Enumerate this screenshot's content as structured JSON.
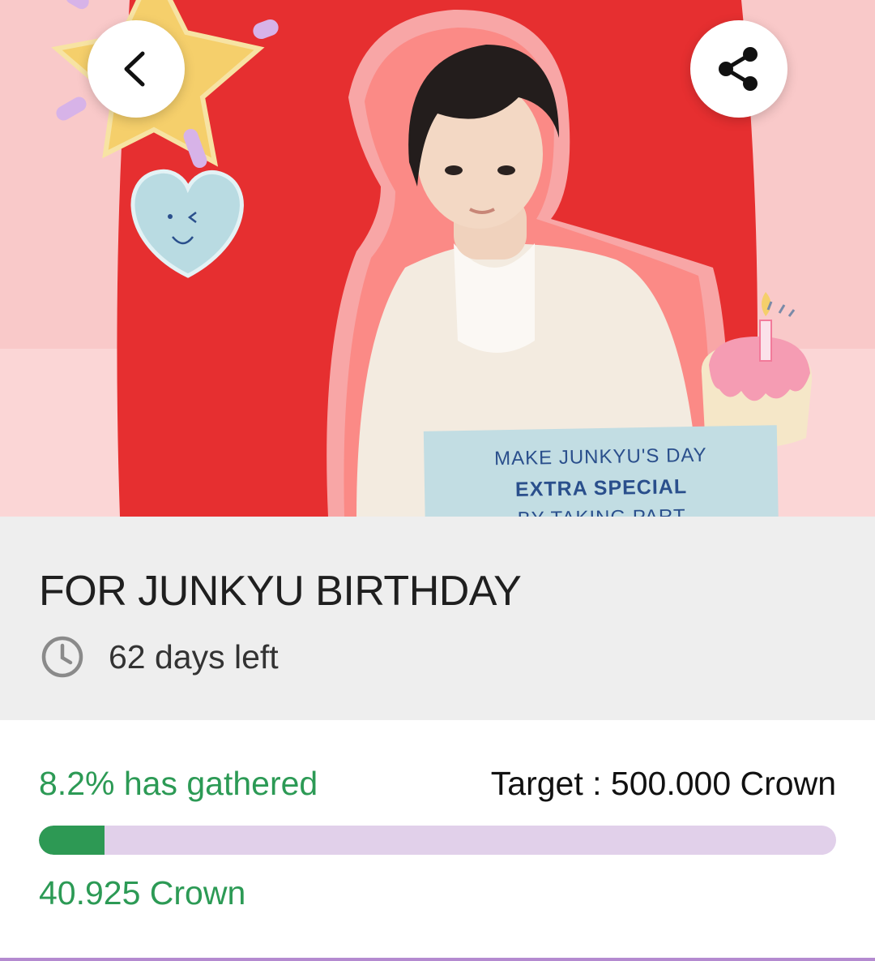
{
  "banner": {
    "caption_line1": "MAKE JUNKYU'S DAY",
    "caption_line2": "EXTRA SPECIAL",
    "caption_line3": "BY TAKING PART"
  },
  "nav": {
    "back_icon": "chevron-left-icon",
    "share_icon": "share-icon"
  },
  "campaign": {
    "title": "FOR JUNKYU BIRTHDAY",
    "clock_icon": "clock-icon",
    "days_left": "62 days left"
  },
  "progress": {
    "gathered_label": "8.2% has gathered",
    "target_label": "Target : 500.000 Crown",
    "collected_label": "40.925 Crown",
    "fraction": 0.082
  },
  "colors": {
    "accent_green": "#2c9a55",
    "track_lavender": "#e1d0ea",
    "banner_red": "#e62f30",
    "banner_pink": "#fbd6d6"
  }
}
